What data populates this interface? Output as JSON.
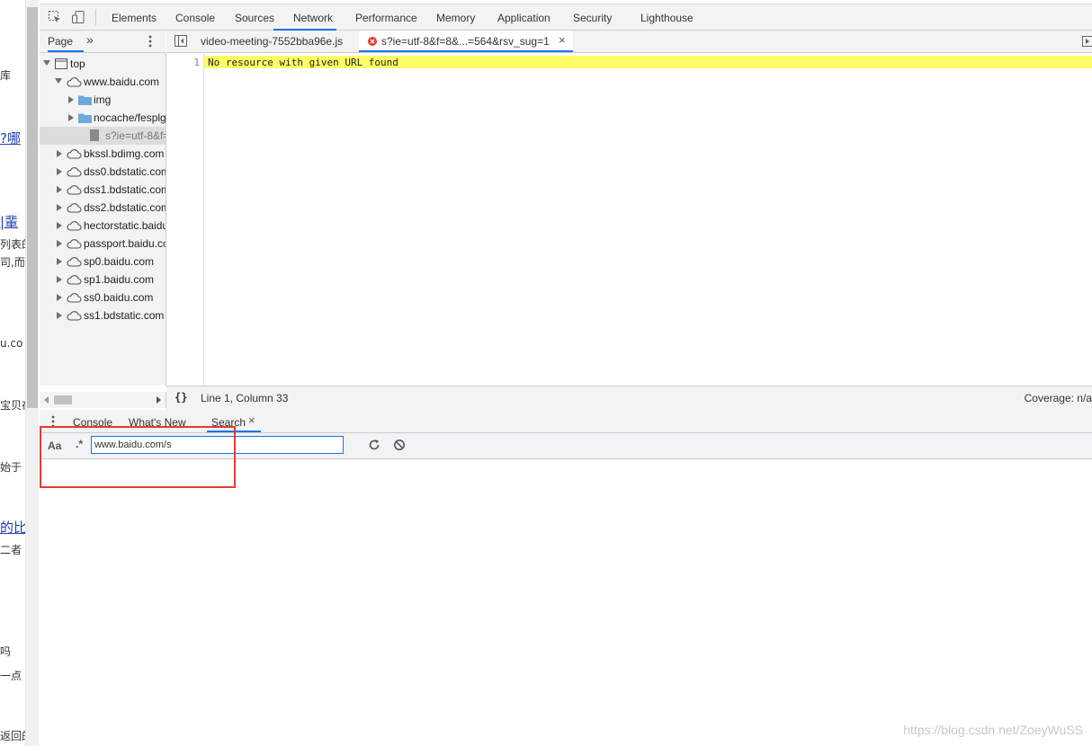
{
  "left_page": {
    "fragments": [
      {
        "text": "库",
        "link": false
      },
      {
        "text": "?哪",
        "link": true
      },
      {
        "text": "|輩",
        "link": true
      },
      {
        "text": "列表的",
        "link": false
      },
      {
        "text": "司,而且",
        "link": false
      },
      {
        "text": "u.co",
        "link": false
      },
      {
        "text": "宝贝在",
        "link": false
      },
      {
        "text": "始于",
        "link": false
      },
      {
        "text": "的比",
        "link": true
      },
      {
        "text": "二者",
        "link": false
      },
      {
        "text": "吗",
        "link": false
      },
      {
        "text": "一点",
        "link": false
      },
      {
        "text": "返回的",
        "link": false
      }
    ]
  },
  "toolbar": {
    "tabs": [
      "Elements",
      "Console",
      "Sources",
      "Network",
      "Performance",
      "Memory",
      "Application",
      "Security",
      "Lighthouse"
    ],
    "active_tab": "Sources"
  },
  "navigator": {
    "tab_label": "Page",
    "more": "»",
    "tree": [
      {
        "label": "top",
        "level": 0,
        "type": "frame",
        "arrow": "down"
      },
      {
        "label": "www.baidu.com",
        "level": 1,
        "type": "cloud",
        "arrow": "down"
      },
      {
        "label": "img",
        "level": 2,
        "type": "folder",
        "arrow": "right"
      },
      {
        "label": "nocache/fesplg",
        "level": 2,
        "type": "folder",
        "arrow": "right"
      },
      {
        "label": "s?ie=utf-8&f=8",
        "level": 3,
        "type": "file",
        "arrow": "none",
        "selected": true
      },
      {
        "label": "bkssl.bdimg.com",
        "level": 1,
        "type": "cloud",
        "arrow": "right"
      },
      {
        "label": "dss0.bdstatic.com",
        "level": 1,
        "type": "cloud",
        "arrow": "right"
      },
      {
        "label": "dss1.bdstatic.com",
        "level": 1,
        "type": "cloud",
        "arrow": "right"
      },
      {
        "label": "dss2.bdstatic.com",
        "level": 1,
        "type": "cloud",
        "arrow": "right"
      },
      {
        "label": "hectorstatic.baidu",
        "level": 1,
        "type": "cloud",
        "arrow": "right"
      },
      {
        "label": "passport.baidu.co",
        "level": 1,
        "type": "cloud",
        "arrow": "right"
      },
      {
        "label": "sp0.baidu.com",
        "level": 1,
        "type": "cloud",
        "arrow": "right"
      },
      {
        "label": "sp1.baidu.com",
        "level": 1,
        "type": "cloud",
        "arrow": "right"
      },
      {
        "label": "ss0.baidu.com",
        "level": 1,
        "type": "cloud",
        "arrow": "right"
      },
      {
        "label": "ss1.bdstatic.com",
        "level": 1,
        "type": "cloud",
        "arrow": "right"
      }
    ]
  },
  "editor": {
    "tabs": [
      {
        "label": "video-meeting-7552bba96e.js",
        "error": false,
        "closable": false
      },
      {
        "label": "s?ie=utf-8&f=8&...=564&rsv_sug=1",
        "error": true,
        "closable": true,
        "active": true
      }
    ],
    "close_glyph": "×",
    "line_number": "1",
    "line_text": "No resource with given URL found",
    "status_position": "Line 1, Column 33",
    "coverage": "Coverage: n/a",
    "pretty_print": "{}"
  },
  "drawer": {
    "tabs": [
      "Console",
      "What's New",
      "Search"
    ],
    "active_tab": "Search",
    "close_glyph": "×"
  },
  "search": {
    "case_label": "Aa",
    "regex_label": ".*",
    "query": "www.baidu.com/s"
  },
  "watermark": "https://blog.csdn.net/ZoeyWuSS",
  "colors": {
    "accent": "#1a73e8",
    "highlight": "#fffe66",
    "annotation": "#e53935",
    "folder": "#6fa8dc",
    "error": "#e53935"
  }
}
